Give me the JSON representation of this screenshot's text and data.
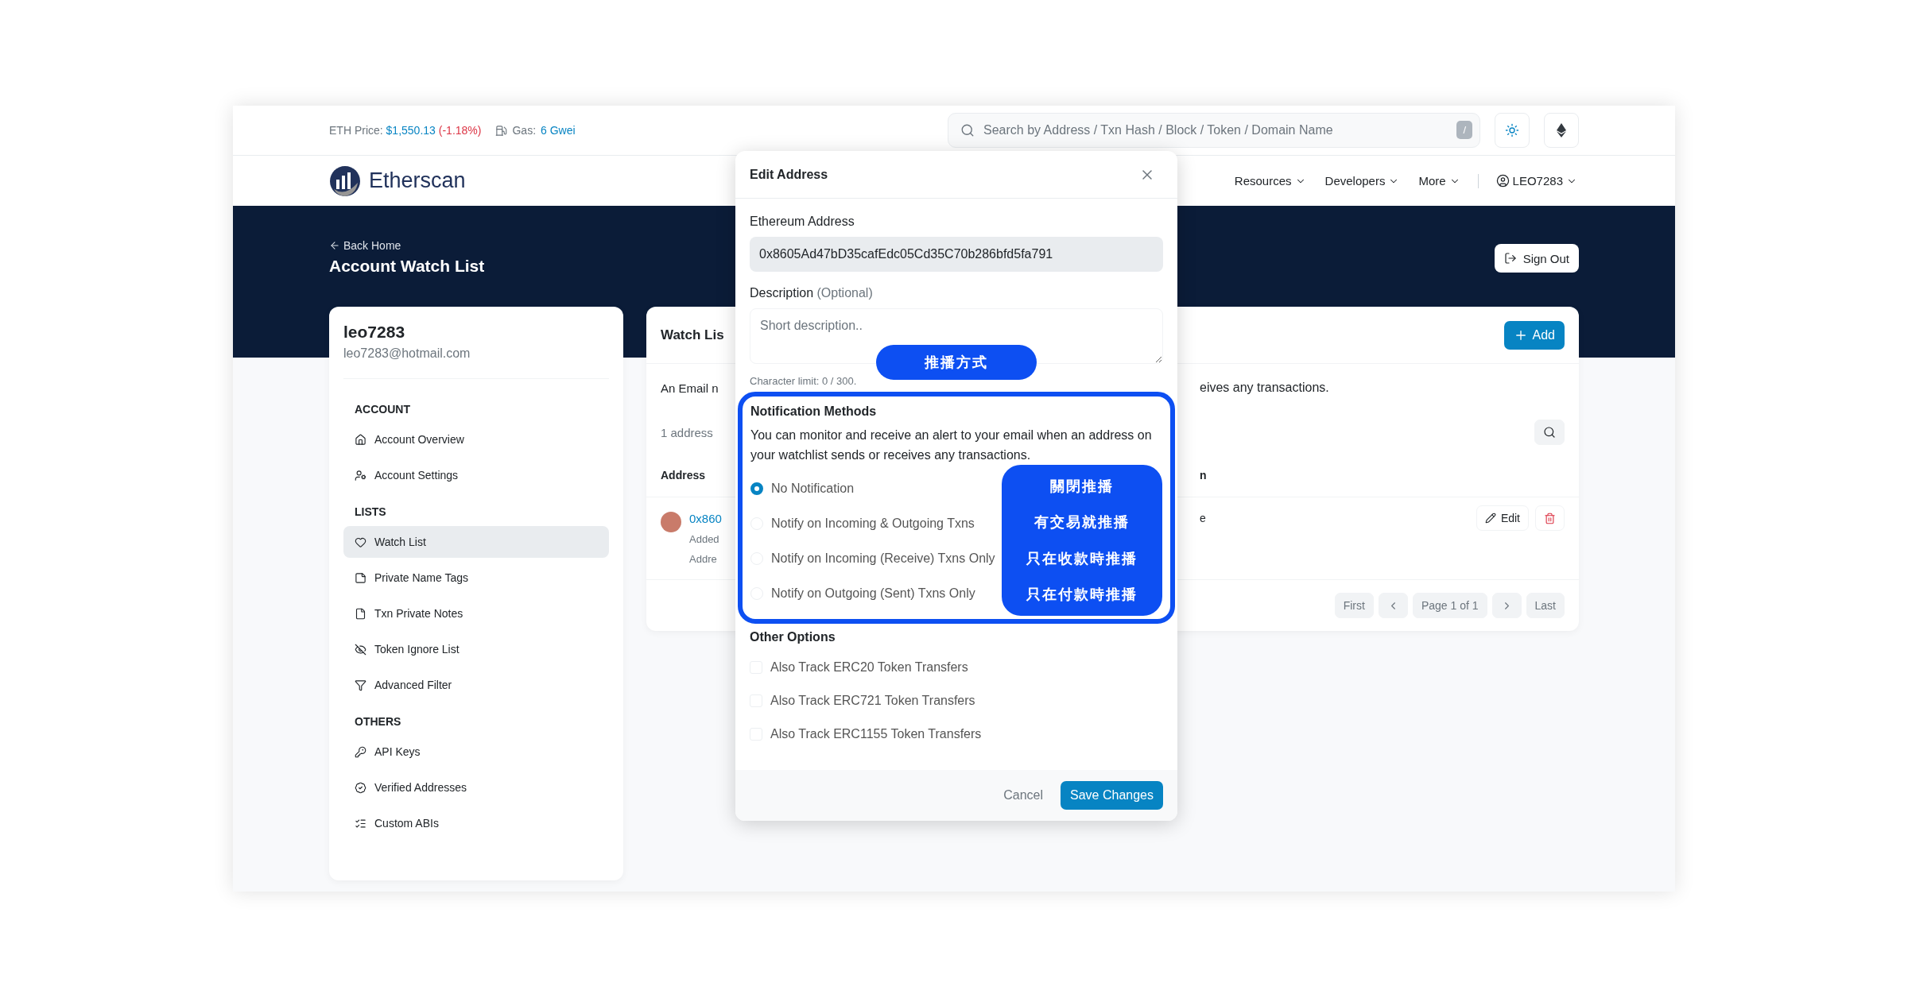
{
  "top_bar": {
    "eth_price_label": "ETH Price:",
    "eth_price": "$1,550.13",
    "eth_change": "(-1.18%)",
    "gas_label": "Gas:",
    "gas_value": "6 Gwei",
    "search": {
      "placeholder": "Search by Address / Txn Hash / Block / Token / Domain Name",
      "shortcut": "/"
    }
  },
  "nav": {
    "logo": "Etherscan",
    "items": [
      {
        "label": "Resources"
      },
      {
        "label": "Developers"
      },
      {
        "label": "More"
      }
    ],
    "user": "LEO7283"
  },
  "hero": {
    "back_link": "Back Home",
    "title": "Account Watch List",
    "sign_out": "Sign Out"
  },
  "sidebar": {
    "username": "leo7283",
    "email": "leo7283@hotmail.com",
    "sections": [
      {
        "heading": "ACCOUNT",
        "items": [
          {
            "label": "Account Overview",
            "selected": false
          },
          {
            "label": "Account Settings",
            "selected": false
          }
        ]
      },
      {
        "heading": "LISTS",
        "items": [
          {
            "label": "Watch List",
            "selected": true
          },
          {
            "label": "Private Name Tags",
            "selected": false
          },
          {
            "label": "Txn Private Notes",
            "selected": false
          },
          {
            "label": "Token Ignore List",
            "selected": false
          },
          {
            "label": "Advanced Filter",
            "selected": false
          }
        ]
      },
      {
        "heading": "OTHERS",
        "items": [
          {
            "label": "API Keys",
            "selected": false
          },
          {
            "label": "Verified Addresses",
            "selected": false
          },
          {
            "label": "Custom ABIs",
            "selected": false
          }
        ]
      }
    ]
  },
  "watch_list": {
    "title": "Watch Lis",
    "add_button": "Add",
    "intro_left": "An Email n",
    "intro_right": "eives any transactions.",
    "count": "1 address",
    "columns": [
      "Address",
      "n"
    ],
    "rows": [
      {
        "address": "0x860",
        "line_2": "Added",
        "line_3": "Addre",
        "column_2": "e",
        "edit": "Edit"
      }
    ],
    "pagination": {
      "first": "First",
      "page": "Page 1 of 1",
      "last": "Last"
    }
  },
  "modal": {
    "title": "Edit Address",
    "address_label": "Ethereum Address",
    "address_value": "0x8605Ad47bD35cafEdc05Cd35C70b286bfd5fa791",
    "description_label": "Description",
    "description_hint": "(Optional)",
    "description": {
      "placeholder": "Short description.."
    },
    "char_limit": "Character limit: 0 / 300.",
    "notification": {
      "heading": "Notification Methods",
      "text": "You can monitor and receive an alert to your email when an address on your watchlist sends or receives any transactions.",
      "options": [
        {
          "label": "No Notification",
          "selected": true
        },
        {
          "label": "Notify on Incoming & Outgoing Txns",
          "selected": false
        },
        {
          "label": "Notify on Incoming (Receive) Txns Only",
          "selected": false
        },
        {
          "label": "Notify on Outgoing (Sent) Txns Only",
          "selected": false
        }
      ]
    },
    "other_options": {
      "heading": "Other Options",
      "options": [
        {
          "label": "Also Track ERC20 Token Transfers",
          "checked": false
        },
        {
          "label": "Also Track ERC721 Token Transfers",
          "checked": false
        },
        {
          "label": "Also Track ERC1155 Token Transfers",
          "checked": false
        }
      ]
    },
    "cancel": "Cancel",
    "save": "Save Changes"
  },
  "annotations": {
    "pill": "推播方式",
    "legend": [
      "關閉推播",
      "有交易就推播",
      "只在收款時推播",
      "只在付款時推播"
    ]
  }
}
